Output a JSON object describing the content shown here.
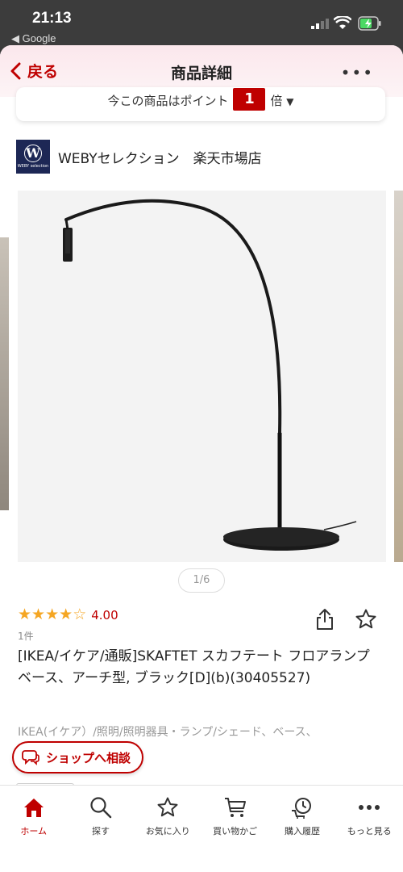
{
  "status_bar": {
    "time": "21:13",
    "back_app": "◀ Google"
  },
  "nav": {
    "back_label": "戻る",
    "title": "商品詳細",
    "more_label": "•••"
  },
  "points": {
    "prefix": "今この商品はポイント",
    "multiplier": "1",
    "suffix": "倍",
    "caret": "▼"
  },
  "shop": {
    "logo_letter": "W",
    "logo_sub": "WEBY selection",
    "name": "WEBYセレクション　楽天市場店"
  },
  "gallery": {
    "pager": "1/6"
  },
  "product": {
    "rating_value": 4.0,
    "rating_text": "4.00",
    "review_count": "1件",
    "title": "[IKEA/イケア/通販]SKAFTET スカフテート フロアランプベース、アーチ型, ブラック[D](b)(30405527)",
    "breadcrumb": "IKEA(イケア）/照明/照明器具・ランプ/シェード、ベース、"
  },
  "consult_button": "ショップへ相談",
  "tabbar": {
    "items": [
      {
        "label": "ホーム",
        "icon": "home-icon",
        "active": true
      },
      {
        "label": "探す",
        "icon": "search-icon",
        "active": false
      },
      {
        "label": "お気に入り",
        "icon": "star-icon",
        "active": false
      },
      {
        "label": "買い物かご",
        "icon": "cart-icon",
        "active": false
      },
      {
        "label": "購入履歴",
        "icon": "history-icon",
        "active": false
      },
      {
        "label": "もっと見る",
        "icon": "more-icon",
        "active": false
      }
    ]
  },
  "colors": {
    "brand": "#bf0000",
    "star": "#f5a623"
  }
}
